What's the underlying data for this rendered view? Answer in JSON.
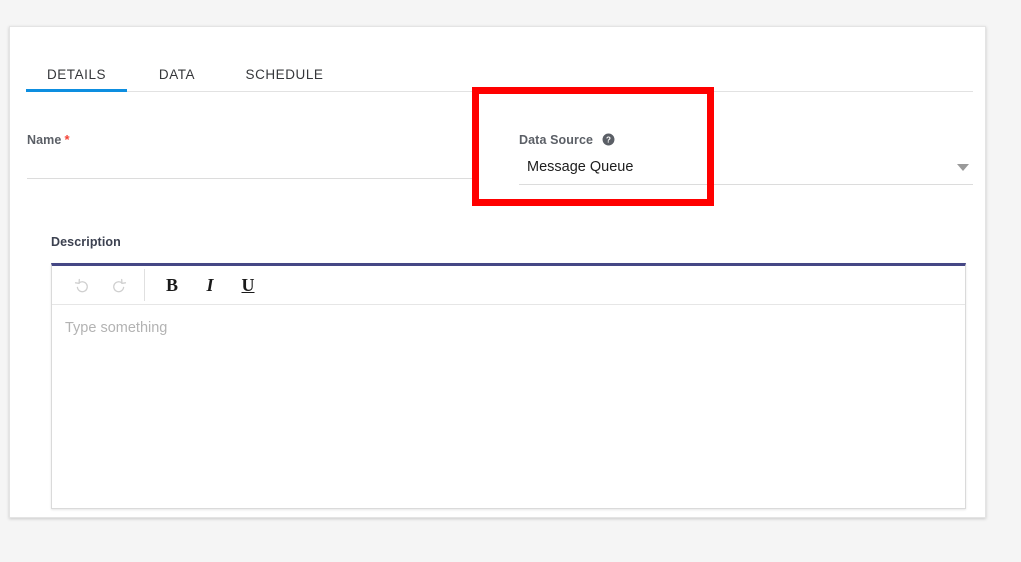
{
  "page": {
    "background_color": "#f5f5f5",
    "card_background": "#ffffff"
  },
  "tabs": {
    "active_color": "#0d8ee0",
    "items": [
      {
        "label": "DETAILS",
        "active": true
      },
      {
        "label": "DATA",
        "active": false
      },
      {
        "label": "SCHEDULE",
        "active": false
      }
    ]
  },
  "form": {
    "name": {
      "label": "Name",
      "required_marker": "*",
      "value": "",
      "placeholder": ""
    },
    "data_source": {
      "label": "Data Source",
      "help_icon": "help-circle-icon",
      "selected_value": "Message Queue",
      "caret_icon": "chevron-down-icon"
    }
  },
  "description": {
    "label": "Description",
    "toolbar": {
      "undo": {
        "icon": "undo-icon",
        "glyph": "↺",
        "enabled": false
      },
      "redo": {
        "icon": "redo-icon",
        "glyph": "↻",
        "enabled": false
      },
      "bold": {
        "icon": "bold-icon",
        "glyph": "B"
      },
      "italic": {
        "icon": "italic-icon",
        "glyph": "I"
      },
      "underline": {
        "icon": "underline-icon",
        "glyph": "U"
      }
    },
    "placeholder": "Type something",
    "value": "",
    "accent_color": "#454785"
  },
  "annotation": {
    "highlight_color": "#ff0000",
    "target": "data-source-field"
  }
}
